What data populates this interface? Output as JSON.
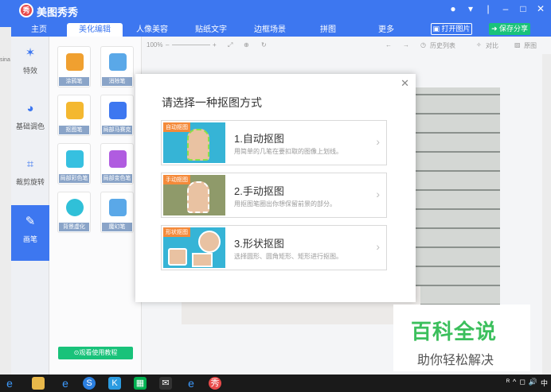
{
  "app": {
    "title": "美图秀秀",
    "logo_text": "秀",
    "edge_text": "sina"
  },
  "window_controls": [
    "skin-icon",
    "menu-icon",
    "minimize-icon",
    "maximize-icon",
    "close-icon"
  ],
  "tabs": [
    {
      "label": "主页",
      "active": false
    },
    {
      "label": "美化编辑",
      "active": true
    },
    {
      "label": "人像美容",
      "active": false
    },
    {
      "label": "贴纸文字",
      "active": false
    },
    {
      "label": "边框场景",
      "active": false
    },
    {
      "label": "拼图",
      "active": false
    },
    {
      "label": "更多",
      "active": false
    }
  ],
  "actions": {
    "open_label": "打开图片",
    "save_label": "保存分享"
  },
  "left_nav": [
    {
      "label": "特效",
      "icon": "magic-wand-icon"
    },
    {
      "label": "基础调色",
      "icon": "palette-icon"
    },
    {
      "label": "裁剪旋转",
      "icon": "crop-icon"
    },
    {
      "label": "画笔",
      "icon": "brush-icon",
      "active": true
    }
  ],
  "tools": [
    {
      "label": "涂鸦笔",
      "icon": "doodle-pen-icon",
      "color": "#f0a030"
    },
    {
      "label": "消除笔",
      "icon": "eraser-icon",
      "color": "#5aa8e8"
    },
    {
      "label": "抠图笔",
      "icon": "cutout-brush-icon",
      "color": "#f4b830"
    },
    {
      "label": "局部马赛克",
      "icon": "mosaic-icon",
      "color": "#3d77f0"
    },
    {
      "label": "局部彩色笔",
      "icon": "color-brush-icon",
      "color": "#36c0e0"
    },
    {
      "label": "局部变色笔",
      "icon": "recolor-brush-icon",
      "color": "#b05ce0"
    },
    {
      "label": "背景虚化",
      "icon": "blur-icon",
      "color": "#30c0d8"
    },
    {
      "label": "魔幻笔",
      "icon": "magic-pen-icon",
      "color": "#5aa8e8"
    }
  ],
  "tutorial_label": "观看使用教程",
  "canvas_toolbar": {
    "zoom": "100%",
    "history": "历史列表",
    "compare": "对比",
    "original": "原图"
  },
  "dialog": {
    "title": "请选择一种抠图方式",
    "options": [
      {
        "tag": "自动抠图",
        "title": "1.自动抠图",
        "desc": "用简单的几笔在要扣取的图像上划线。"
      },
      {
        "tag": "手动抠图",
        "title": "2.手动抠图",
        "desc": "用抠图笔圈出你想保留前景的部分。"
      },
      {
        "tag": "形状抠图",
        "title": "3.形状抠图",
        "desc": "选择圆形、圆角矩形、矩形进行抠图。"
      }
    ]
  },
  "watermark": {
    "line1": "百科全说",
    "line2": "助你轻松解决"
  },
  "taskbar": {
    "icons": [
      "edge-icon",
      "file-explorer-icon",
      "ie-icon",
      "sogou-icon",
      "kugou-icon",
      "iqiyi-icon",
      "mail-icon",
      "ie-alt-icon",
      "meitu-icon"
    ],
    "tray": [
      "ᴿ",
      "^",
      "◻",
      "🔊",
      "中"
    ]
  }
}
